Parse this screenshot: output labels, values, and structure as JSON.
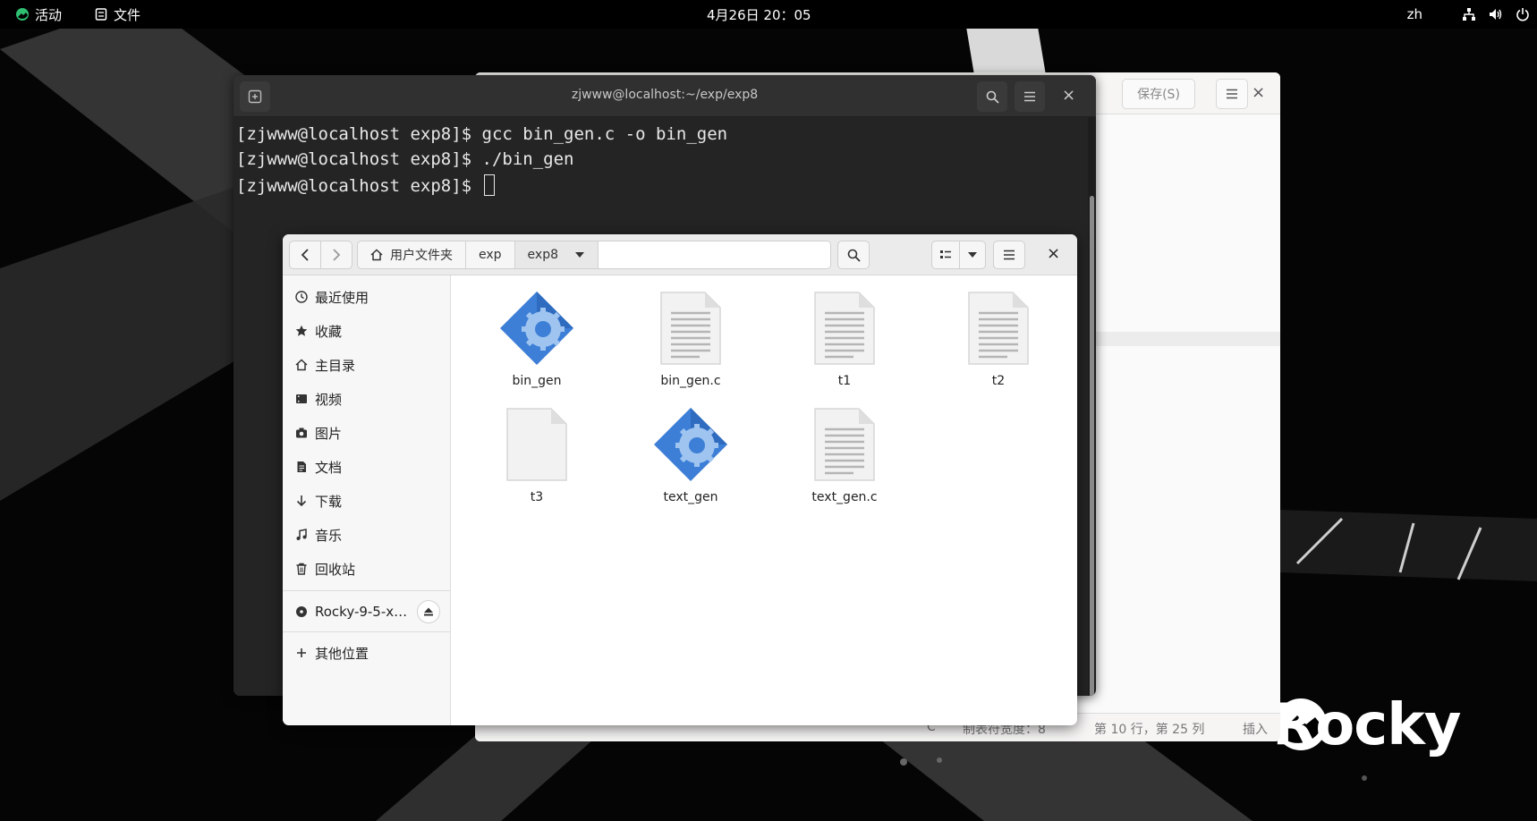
{
  "topbar": {
    "activities": "活动",
    "app": "文件",
    "clock": "4月26日  20：05",
    "lang": "zh"
  },
  "editor": {
    "save": "保存(S)",
    "status_lang": "C",
    "status_tab": "制表符宽度：8",
    "status_pos": "第 10 行，第 25 列",
    "status_mode": "插入"
  },
  "terminal": {
    "title": "zjwww@localhost:~/exp/exp8",
    "lines": [
      "[zjwww@localhost exp8]$ gcc bin_gen.c -o bin_gen",
      "[zjwww@localhost exp8]$ ./bin_gen",
      "[zjwww@localhost exp8]$ "
    ]
  },
  "files": {
    "path": [
      "用户文件夹",
      "exp",
      "exp8"
    ],
    "sidebar": [
      {
        "label": "最近使用",
        "icon": "clock-icon"
      },
      {
        "label": "收藏",
        "icon": "star-icon"
      },
      {
        "label": "主目录",
        "icon": "home-icon"
      },
      {
        "label": "视频",
        "icon": "video-icon"
      },
      {
        "label": "图片",
        "icon": "camera-icon"
      },
      {
        "label": "文档",
        "icon": "document-icon"
      },
      {
        "label": "下载",
        "icon": "download-icon"
      },
      {
        "label": "音乐",
        "icon": "music-icon"
      },
      {
        "label": "回收站",
        "icon": "trash-icon"
      }
    ],
    "device": "Rocky-9-5-x…",
    "other": "其他位置",
    "items": [
      {
        "name": "bin_gen",
        "type": "executable"
      },
      {
        "name": "bin_gen.c",
        "type": "text"
      },
      {
        "name": "t1",
        "type": "text"
      },
      {
        "name": "t2",
        "type": "text"
      },
      {
        "name": "t3",
        "type": "blank"
      },
      {
        "name": "text_gen",
        "type": "executable"
      },
      {
        "name": "text_gen.c",
        "type": "text"
      }
    ]
  },
  "brand": "Rocky"
}
